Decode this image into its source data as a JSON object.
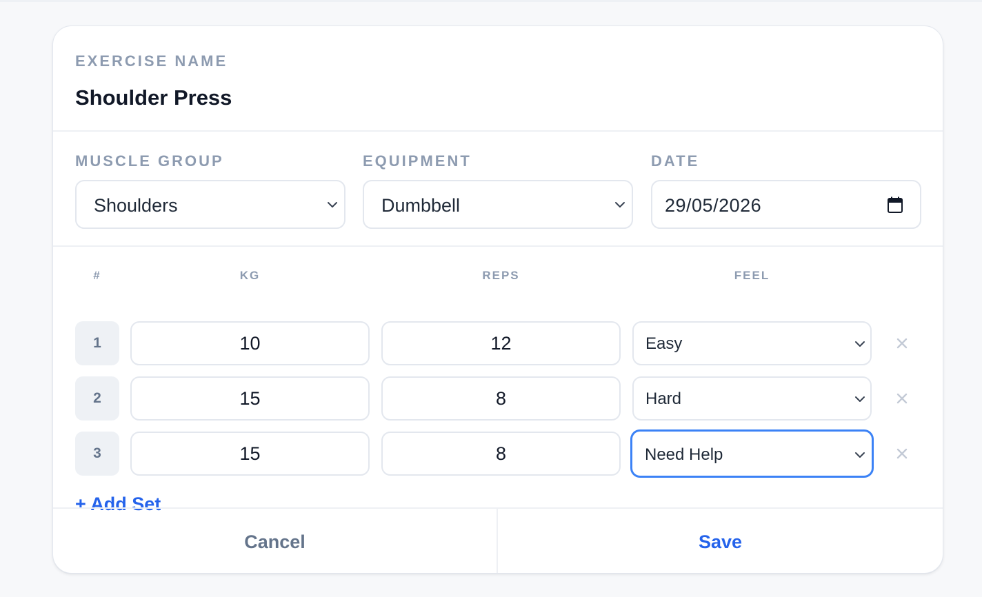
{
  "exercise": {
    "label": "EXERCISE NAME",
    "name": "Shoulder Press"
  },
  "meta": {
    "muscle_group": {
      "label": "MUSCLE GROUP",
      "value": "Shoulders"
    },
    "equipment": {
      "label": "EQUIPMENT",
      "value": "Dumbbell"
    },
    "date": {
      "label": "DATE",
      "value": "29/05/2026"
    }
  },
  "sets": {
    "headers": {
      "num": "#",
      "kg": "KG",
      "reps": "REPS",
      "feel": "FEEL"
    },
    "rows": [
      {
        "num": "1",
        "kg": "10",
        "reps": "12",
        "feel": "Easy"
      },
      {
        "num": "2",
        "kg": "15",
        "reps": "8",
        "feel": "Hard"
      },
      {
        "num": "3",
        "kg": "15",
        "reps": "8",
        "feel": "Need Help"
      }
    ],
    "add_label": "+ Add Set"
  },
  "footer": {
    "cancel_label": "Cancel",
    "save_label": "Save"
  },
  "icons": {
    "select": "chevron-down-icon",
    "date": "calendar-icon",
    "remove": "close-icon"
  },
  "colors": {
    "accent": "#2563eb",
    "focus_ring": "#3b82f6",
    "label": "#8d9bb0",
    "muted_button": "#64748b"
  }
}
